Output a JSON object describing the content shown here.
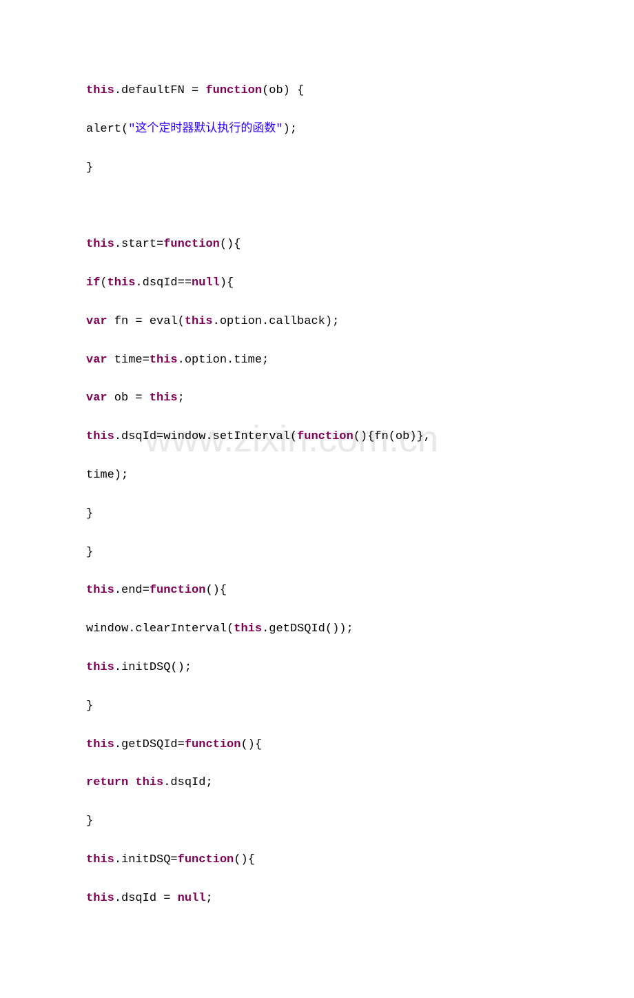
{
  "watermark": "www.zixin.com.cn",
  "lines": [
    {
      "segments": [
        {
          "class": "keyword",
          "text": "this"
        },
        {
          "class": "normal",
          "text": ".defaultFN = "
        },
        {
          "class": "keyword",
          "text": "function"
        },
        {
          "class": "normal",
          "text": "(ob) {"
        }
      ]
    },
    {
      "segments": [
        {
          "class": "normal",
          "text": "alert("
        },
        {
          "class": "string",
          "text": "\"这个定时器默认执行的函数\""
        },
        {
          "class": "normal",
          "text": ");"
        }
      ]
    },
    {
      "segments": [
        {
          "class": "normal",
          "text": "}"
        }
      ]
    },
    {
      "segments": [
        {
          "class": "normal",
          "text": " "
        }
      ]
    },
    {
      "segments": [
        {
          "class": "keyword",
          "text": "this"
        },
        {
          "class": "normal",
          "text": ".start="
        },
        {
          "class": "keyword",
          "text": "function"
        },
        {
          "class": "normal",
          "text": "(){"
        }
      ]
    },
    {
      "segments": [
        {
          "class": "keyword",
          "text": "if"
        },
        {
          "class": "normal",
          "text": "("
        },
        {
          "class": "keyword",
          "text": "this"
        },
        {
          "class": "normal",
          "text": ".dsqId=="
        },
        {
          "class": "keyword",
          "text": "null"
        },
        {
          "class": "normal",
          "text": "){"
        }
      ]
    },
    {
      "segments": [
        {
          "class": "keyword",
          "text": "var"
        },
        {
          "class": "normal",
          "text": " fn = eval("
        },
        {
          "class": "keyword",
          "text": "this"
        },
        {
          "class": "normal",
          "text": ".option.callback);"
        }
      ]
    },
    {
      "segments": [
        {
          "class": "keyword",
          "text": "var"
        },
        {
          "class": "normal",
          "text": " time="
        },
        {
          "class": "keyword",
          "text": "this"
        },
        {
          "class": "normal",
          "text": ".option.time;"
        }
      ]
    },
    {
      "segments": [
        {
          "class": "keyword",
          "text": "var"
        },
        {
          "class": "normal",
          "text": " ob = "
        },
        {
          "class": "keyword",
          "text": "this"
        },
        {
          "class": "normal",
          "text": ";"
        }
      ]
    },
    {
      "segments": [
        {
          "class": "keyword",
          "text": "this"
        },
        {
          "class": "normal",
          "text": ".dsqId=window.setInterval("
        },
        {
          "class": "keyword",
          "text": "function"
        },
        {
          "class": "normal",
          "text": "(){fn(ob)},"
        }
      ]
    },
    {
      "segments": [
        {
          "class": "normal",
          "text": "time);"
        }
      ]
    },
    {
      "segments": [
        {
          "class": "normal",
          "text": "}"
        }
      ]
    },
    {
      "segments": [
        {
          "class": "normal",
          "text": "}"
        }
      ]
    },
    {
      "segments": [
        {
          "class": "keyword",
          "text": "this"
        },
        {
          "class": "normal",
          "text": ".end="
        },
        {
          "class": "keyword",
          "text": "function"
        },
        {
          "class": "normal",
          "text": "(){"
        }
      ]
    },
    {
      "segments": [
        {
          "class": "normal",
          "text": "window.clearInterval("
        },
        {
          "class": "keyword",
          "text": "this"
        },
        {
          "class": "normal",
          "text": ".getDSQId());"
        }
      ]
    },
    {
      "segments": [
        {
          "class": "keyword",
          "text": "this"
        },
        {
          "class": "normal",
          "text": ".initDSQ();"
        }
      ]
    },
    {
      "segments": [
        {
          "class": "normal",
          "text": "}"
        }
      ]
    },
    {
      "segments": [
        {
          "class": "keyword",
          "text": "this"
        },
        {
          "class": "normal",
          "text": ".getDSQId="
        },
        {
          "class": "keyword",
          "text": "function"
        },
        {
          "class": "normal",
          "text": "(){"
        }
      ]
    },
    {
      "segments": [
        {
          "class": "keyword",
          "text": "return"
        },
        {
          "class": "normal",
          "text": " "
        },
        {
          "class": "keyword",
          "text": "this"
        },
        {
          "class": "normal",
          "text": ".dsqId;"
        }
      ]
    },
    {
      "segments": [
        {
          "class": "normal",
          "text": "}"
        }
      ]
    },
    {
      "segments": [
        {
          "class": "keyword",
          "text": "this"
        },
        {
          "class": "normal",
          "text": ".initDSQ="
        },
        {
          "class": "keyword",
          "text": "function"
        },
        {
          "class": "normal",
          "text": "(){"
        }
      ]
    },
    {
      "segments": [
        {
          "class": "keyword",
          "text": "this"
        },
        {
          "class": "normal",
          "text": ".dsqId = "
        },
        {
          "class": "keyword",
          "text": "null"
        },
        {
          "class": "normal",
          "text": ";"
        }
      ]
    }
  ]
}
